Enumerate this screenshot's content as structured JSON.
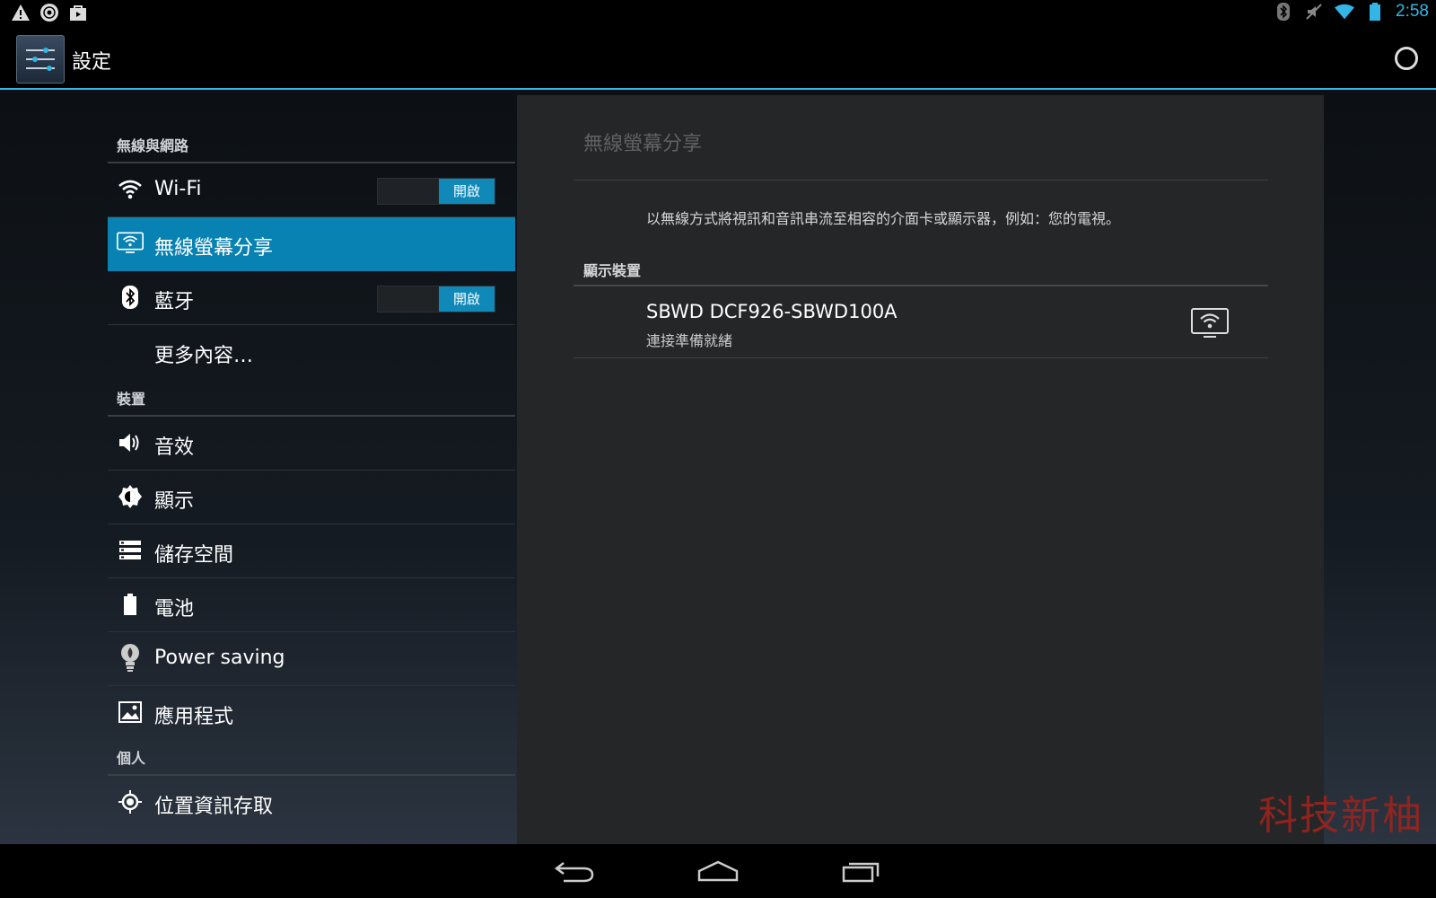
{
  "status_bar": {
    "left_icons": [
      "warning-icon",
      "signal-circle-icon",
      "shopping-bag-icon"
    ],
    "right_icons": [
      "bluetooth-icon",
      "mute-icon",
      "wifi-icon",
      "battery-icon"
    ],
    "time": "2:58"
  },
  "action_bar": {
    "title": "設定",
    "icon": "settings-sliders-icon",
    "action_icon": "refresh-icon"
  },
  "sidebar": {
    "sections": [
      {
        "header": "無線與網路"
      },
      {
        "header": "裝置"
      },
      {
        "header": "個人"
      }
    ],
    "items": [
      {
        "label": "Wi-Fi",
        "icon": "wifi-icon",
        "toggle": "開啟"
      },
      {
        "label": "無線螢幕分享",
        "icon": "wireless-display-icon",
        "selected": true
      },
      {
        "label": "藍牙",
        "icon": "bluetooth-icon",
        "toggle": "開啟"
      },
      {
        "label": "更多內容…",
        "icon": ""
      },
      {
        "label": "音效",
        "icon": "speaker-icon"
      },
      {
        "label": "顯示",
        "icon": "brightness-icon"
      },
      {
        "label": "儲存空間",
        "icon": "storage-icon"
      },
      {
        "label": "電池",
        "icon": "battery-icon"
      },
      {
        "label": "Power saving",
        "icon": "lightbulb-icon"
      },
      {
        "label": "應用程式",
        "icon": "apps-icon"
      },
      {
        "label": "位置資訊存取",
        "icon": "location-icon"
      }
    ]
  },
  "detail_pane": {
    "title": "無線螢幕分享",
    "description": "以無線方式將視訊和音訊串流至相容的介面卡或顯示器，例如：您的電視。",
    "section_header": "顯示裝置",
    "devices": [
      {
        "name": "SBWD DCF926-SBWD100A",
        "status": "連接準備就緒",
        "icon": "wireless-display-icon"
      }
    ]
  },
  "watermark": "科技新柚",
  "nav_bar": {
    "buttons": [
      "back-icon",
      "home-icon",
      "recent-apps-icon"
    ]
  },
  "colors": {
    "accent": "#33b5e5",
    "selected": "#0882b2",
    "pane_bg": "#252628"
  }
}
